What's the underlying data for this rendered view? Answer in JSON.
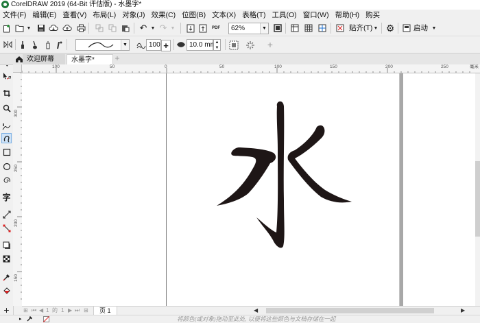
{
  "window": {
    "title": "CorelDRAW 2019 (64-Bit 评估版) - 水墨字*"
  },
  "menu": [
    "文件(F)",
    "编辑(E)",
    "查看(V)",
    "布局(L)",
    "对象(J)",
    "效果(C)",
    "位图(B)",
    "文本(X)",
    "表格(T)",
    "工具(O)",
    "窗口(W)",
    "帮助(H)",
    "购买"
  ],
  "toolbar": {
    "zoom_value": "62%",
    "snap_label": "贴齐(T)",
    "launch_label": "启动",
    "pdf_label": "PDF"
  },
  "property_bar": {
    "smoothing_value": "100",
    "width_value": "10.0 mm"
  },
  "tabs": {
    "welcome": "欢迎屏幕",
    "document": "水墨字*"
  },
  "ruler": {
    "h_labels": [
      "100",
      "50",
      "0",
      "50",
      "100",
      "150",
      "200",
      "250",
      "毫米"
    ],
    "v_labels": [
      "300",
      "250",
      "200",
      "150",
      "100"
    ]
  },
  "page_nav": {
    "current": "1",
    "of_label": "的",
    "total": "1",
    "page_tab": "页 1"
  },
  "status": {
    "hint": "将颜色(或对象)拖动至此处, 以便将这些颜色与文档存储在一起"
  },
  "icons": [
    "new-icon",
    "open-icon",
    "save-icon",
    "cloud-download-icon",
    "cloud-upload-icon",
    "print-icon",
    "undo-icon",
    "redo-icon",
    "import-icon",
    "export-icon",
    "fullscreen-icon",
    "gear-icon",
    "pick-tool-icon",
    "shape-tool-icon",
    "crop-tool-icon",
    "zoom-tool-icon",
    "freehand-tool-icon",
    "artistic-media-tool-icon",
    "rectangle-tool-icon",
    "ellipse-tool-icon",
    "spiral-tool-icon",
    "text-tool-icon",
    "dimension-tool-icon",
    "connector-tool-icon",
    "shadow-tool-icon",
    "transparency-tool-icon",
    "eyedropper-tool-icon",
    "fill-tool-icon",
    "add-icon"
  ],
  "colors": {
    "ink": "#1e1616",
    "canvas": "#ffffff",
    "chrome": "#f0f0f0"
  }
}
